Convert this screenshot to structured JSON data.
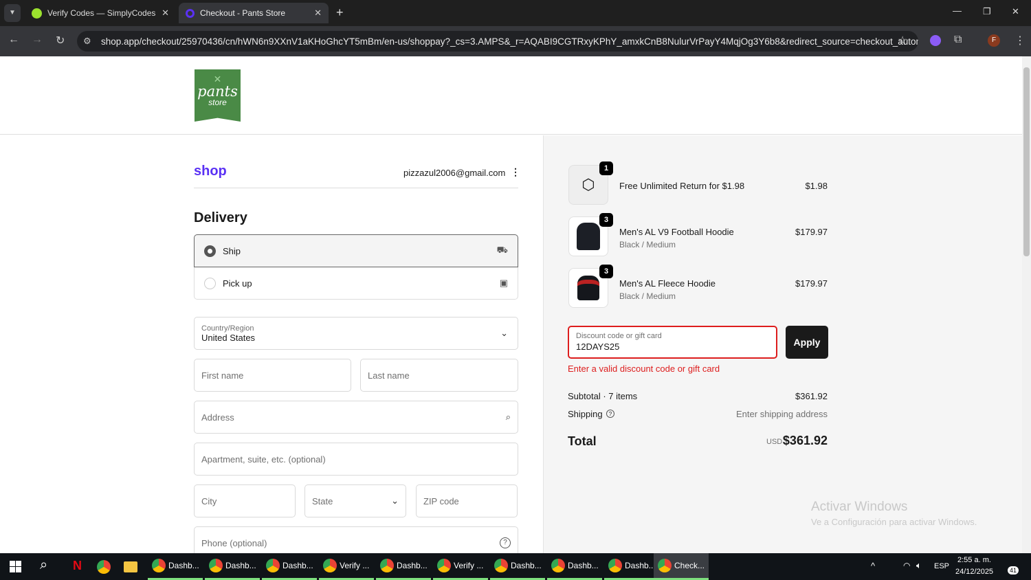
{
  "browser": {
    "tabs": [
      {
        "label": "Verify Codes — SimplyCodes"
      },
      {
        "label": "Checkout - Pants Store"
      }
    ],
    "url": "shop.app/checkout/25970436/cn/hWN6n9XXnV1aKHoGhcYT5mBm/en-us/shoppay?_cs=3.AMPS&_r=AQABI9CGTRxyKPhY_amxkCnB8NulurVrPayY4MqjOg3Y6b8&redirect_source=checkout_automa...",
    "profile": "F"
  },
  "store": {
    "logo_text": "pants",
    "logo_sub": "store"
  },
  "account": {
    "brand": "shop",
    "email": "pizzazul2006@gmail.com"
  },
  "delivery": {
    "title": "Delivery",
    "options": [
      {
        "label": "Ship",
        "selected": true
      },
      {
        "label": "Pick up",
        "selected": false
      }
    ],
    "country_label": "Country/Region",
    "country_value": "United States",
    "first_name": "First name",
    "last_name": "Last name",
    "address": "Address",
    "apartment": "Apartment, suite, etc. (optional)",
    "city": "City",
    "state": "State",
    "zip": "ZIP code",
    "phone": "Phone (optional)"
  },
  "order": {
    "items": [
      {
        "qty": "1",
        "name": "Free Unlimited Return for $1.98",
        "variant": "",
        "price": "$1.98"
      },
      {
        "qty": "3",
        "name": "Men's AL V9 Football Hoodie",
        "variant": "Black / Medium",
        "price": "$179.97"
      },
      {
        "qty": "3",
        "name": "Men's AL Fleece Hoodie",
        "variant": "Black / Medium",
        "price": "$179.97"
      }
    ],
    "discount_label": "Discount code or gift card",
    "discount_value": "12DAYS25",
    "apply": "Apply",
    "error": "Enter a valid discount code or gift card",
    "subtotal_label": "Subtotal · 7 items",
    "subtotal": "$361.92",
    "shipping_label": "Shipping",
    "shipping_value": "Enter shipping address",
    "total_label": "Total",
    "currency": "USD",
    "total": "$361.92"
  },
  "watermark": {
    "title": "Activar Windows",
    "sub": "Ve a Configuración para activar Windows."
  },
  "taskbar": {
    "tasks": [
      "Dashb...",
      "Dashb...",
      "Dashb...",
      "Verify ...",
      "Dashb...",
      "Verify ...",
      "Dashb...",
      "Dashb...",
      "Dashb...",
      "Check..."
    ],
    "lang": "ESP",
    "time": "2:55 a. m.",
    "date": "24/12/2025",
    "notifications": "41"
  },
  "colors": {
    "accent": "#5a31f4",
    "error": "#dd1d1d",
    "logo": "#4a8a46"
  }
}
